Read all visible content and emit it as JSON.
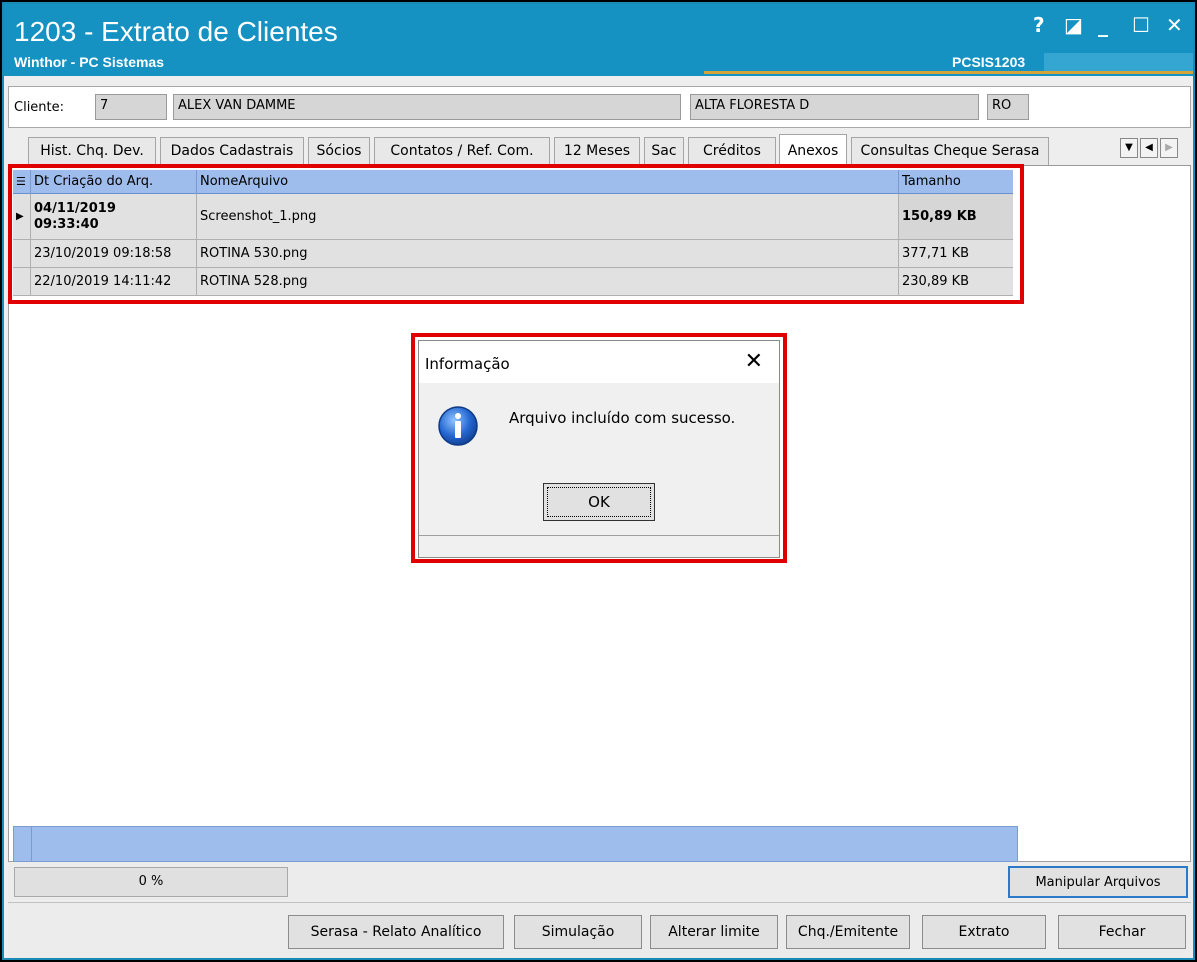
{
  "window": {
    "title": "1203 - Extrato de Clientes",
    "subtitle": "Winthor - PC Sistemas",
    "code": "PCSIS1203",
    "controls": {
      "help": "?",
      "restore": "◪",
      "minimize": "_",
      "maximize": "☐",
      "close": "✕"
    }
  },
  "client": {
    "label": "Cliente:",
    "code": "7",
    "name": "ALEX VAN DAMME",
    "city": "ALTA FLORESTA D",
    "state": "RO"
  },
  "tabs": [
    {
      "label": "Hist. Chq. Dev."
    },
    {
      "label": "Dados Cadastrais"
    },
    {
      "label": "Sócios"
    },
    {
      "label": "Contatos / Ref. Com."
    },
    {
      "label": "12 Meses"
    },
    {
      "label": "Sac"
    },
    {
      "label": "Créditos"
    },
    {
      "label": "Anexos"
    },
    {
      "label": "Consultas Cheque Serasa"
    }
  ],
  "active_tab": "Anexos",
  "grid": {
    "columns": [
      "Dt Criação do Arq.",
      "NomeArquivo",
      "Tamanho"
    ],
    "rows": [
      {
        "date": "04/11/2019\n09:33:40",
        "name": "Screenshot_1.png",
        "size": "150,89 KB"
      },
      {
        "date": "23/10/2019 09:18:58",
        "name": "ROTINA 530.png",
        "size": "377,71 KB"
      },
      {
        "date": "22/10/2019 14:11:42",
        "name": "ROTINA 528.png",
        "size": "230,89 KB"
      }
    ]
  },
  "progress": {
    "text": "0 %"
  },
  "buttons": {
    "manipular": "Manipular Arquivos",
    "serasa": "Serasa - Relato Analítico",
    "simulacao": "Simulação",
    "alterar": "Alterar limite",
    "chq": "Chq./Emitente",
    "extrato": "Extrato",
    "fechar": "Fechar"
  },
  "dialog": {
    "title": "Informação",
    "close": "✕",
    "message": "Arquivo incluído com sucesso.",
    "ok": "OK"
  },
  "colors": {
    "titlebar": "#1592c2",
    "grid_header": "#9ebcec",
    "highlight": "#e00000"
  }
}
